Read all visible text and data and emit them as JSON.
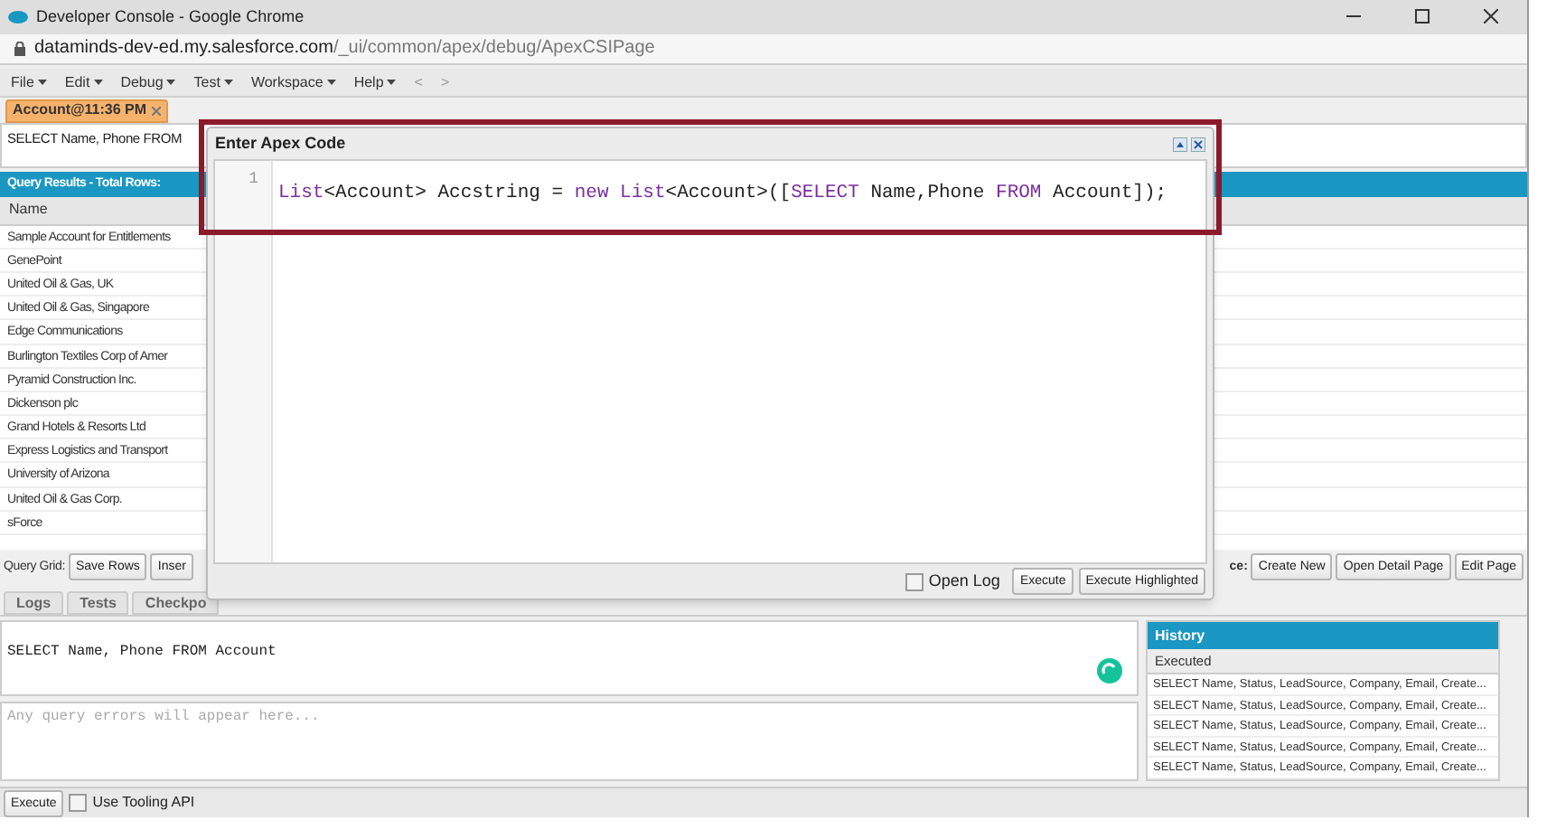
{
  "window": {
    "title": "Developer Console - Google Chrome"
  },
  "address_bar": {
    "host": "dataminds-dev-ed.my.salesforce.com",
    "path": "/_ui/common/apex/debug/ApexCSIPage"
  },
  "menu": [
    {
      "label": "File"
    },
    {
      "label": "Edit"
    },
    {
      "label": "Debug"
    },
    {
      "label": "Test"
    },
    {
      "label": "Workspace"
    },
    {
      "label": "Help"
    }
  ],
  "nav": [
    "<",
    ">"
  ],
  "editor_tabs": [
    {
      "label": "Account@11:36 PM",
      "selected": true
    }
  ],
  "query_text": "SELECT Name, Phone FROM",
  "query_results": {
    "title": "Query Results - Total Rows:",
    "columns": [
      "Name"
    ],
    "rows": [
      "Sample Account for Entitlements",
      "GenePoint",
      "United Oil & Gas, UK",
      "United Oil & Gas, Singapore",
      "Edge Communications",
      "Burlington Textiles Corp of Amer",
      "Pyramid Construction Inc.",
      "Dickenson plc",
      "Grand Hotels & Resorts Ltd",
      "Express Logistics and Transport",
      "University of Arizona",
      "United Oil & Gas Corp.",
      "sForce"
    ],
    "grid_label": "Query Grid:",
    "grid_buttons": [
      "Save Rows",
      "Inser"
    ],
    "record_label": "ce:",
    "record_buttons": [
      "Create New",
      "Open Detail Page",
      "Edit Page"
    ]
  },
  "bottom_tabs": [
    {
      "label": "Logs",
      "selected": false
    },
    {
      "label": "Tests",
      "selected": false
    },
    {
      "label": "Checkpo",
      "selected": false
    }
  ],
  "query_editor": {
    "value": "SELECT Name, Phone FROM Account",
    "errors_placeholder": "Any query errors will appear here..."
  },
  "history": {
    "title": "History",
    "column": "Executed",
    "rows": [
      "SELECT Name, Status, LeadSource, Company, Email, Create...",
      "SELECT Name, Status, LeadSource, Company, Email, Create...",
      "SELECT Name, Status, LeadSource, Company, Email, Create...",
      "SELECT Name, Status, LeadSource, Company, Email, Create...",
      "SELECT Name, Status, LeadSource, Company, Email, Create..."
    ]
  },
  "footer": {
    "button": "Execute",
    "tooling_api": {
      "label": "Use Tooling API",
      "checked": false
    }
  },
  "dialog": {
    "title": "Enter Apex Code",
    "line_number": "1",
    "code": [
      {
        "text": "List",
        "kind": "keyword"
      },
      {
        "text": "<Account> Accstring = ",
        "kind": "plain"
      },
      {
        "text": "new",
        "kind": "keyword"
      },
      {
        "text": " List",
        "kind": "keyword"
      },
      {
        "text": "<Account>([",
        "kind": "plain"
      },
      {
        "text": "SELECT",
        "kind": "keyword"
      },
      {
        "text": " Name,Phone ",
        "kind": "plain"
      },
      {
        "text": "FROM",
        "kind": "keyword"
      },
      {
        "text": " Account]);",
        "kind": "plain"
      }
    ],
    "open_log": {
      "label": "Open Log",
      "checked": false
    },
    "buttons": [
      "Execute",
      "Execute Highlighted"
    ]
  }
}
